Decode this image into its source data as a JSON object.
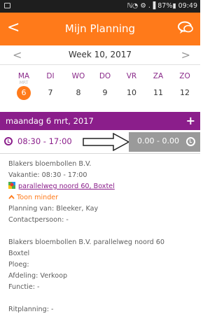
{
  "status_bar": {
    "right": "ℕ◔ ⚙ .▐ 87%▮ 09:49"
  },
  "app_bar": {
    "back": "<",
    "title": "Mijn Planning"
  },
  "week_nav": {
    "prev": "<",
    "label": "Week 10, 2017",
    "next": ">"
  },
  "days": [
    {
      "name": "MA",
      "sub": "MRT",
      "num": "6",
      "active": true
    },
    {
      "name": "DI",
      "sub": "",
      "num": "7"
    },
    {
      "name": "WO",
      "sub": "",
      "num": "8"
    },
    {
      "name": "DO",
      "sub": "",
      "num": "9"
    },
    {
      "name": "VR",
      "sub": "",
      "num": "10"
    },
    {
      "name": "ZA",
      "sub": "",
      "num": "11"
    },
    {
      "name": "ZO",
      "sub": "",
      "num": "12"
    }
  ],
  "date_header": {
    "text": "maandag 6 mrt, 2017",
    "plus": "+"
  },
  "time_row": {
    "planned": "08:30 - 17:00",
    "actual": "0.00 - 0.00"
  },
  "details": {
    "company": "Blakers bloembollen B.V.",
    "vacation": "Vakantie: 08:30 - 17:00",
    "address_link": "parallelweg noord 60, Boxtel",
    "toon_minder": "Toon minder",
    "planning_van": "Planning van: Bleeker, Kay",
    "contact": "Contactpersoon: -",
    "company_address": "Blakers bloembollen B.V. parallelweg noord 60",
    "city": "Boxtel",
    "ploeg": "Ploeg:",
    "afdeling": "Afdeling: Verkoop",
    "functie": "Functie: -",
    "ritplanning": "Ritplanning: -"
  },
  "colors": {
    "accent_orange": "#ff7a1a",
    "purple": "#8b1e8b",
    "gray_box": "#9a9a9a"
  },
  "icons": [
    "back-icon",
    "chat-icon",
    "clock-icon",
    "map-pin-icon",
    "chevron-up-icon",
    "plus-icon",
    "arrow-annotation-icon"
  ]
}
